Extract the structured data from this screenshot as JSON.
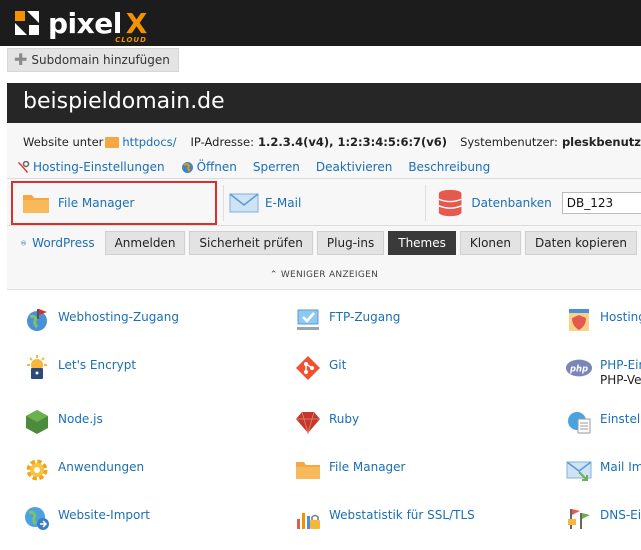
{
  "brand": {
    "name": "pixel",
    "mark": "X",
    "tagline": "CLOUD"
  },
  "toolbar": {
    "add_subdomain_label": "Subdomain hinzufügen"
  },
  "domain": {
    "title": "beispieldomain.de",
    "website_prefix": "Website unter",
    "docroot": "httpdocs/",
    "ip_label": "IP-Adresse:",
    "ip_value": "1.2.3.4(v4), 1:2:3:4:5:6:7(v6)",
    "user_label": "Systembenutzer:",
    "user_value": "pleskbenutzer"
  },
  "actions": [
    {
      "label": "Hosting-Einstellungen",
      "icon": "wrench-icon"
    },
    {
      "label": "Öffnen",
      "icon": "globe-icon"
    },
    {
      "label": "Sperren"
    },
    {
      "label": "Deaktivieren"
    },
    {
      "label": "Beschreibung"
    }
  ],
  "tools": {
    "file_manager": "File Manager",
    "email": "E-Mail",
    "databases": "Datenbanken",
    "db_selected": "DB_123"
  },
  "wordpress": {
    "label": "WordPress",
    "buttons": [
      "Anmelden",
      "Sicherheit prüfen",
      "Plug-ins",
      "Themes",
      "Klonen",
      "Daten kopieren"
    ],
    "active": "Themes"
  },
  "show_less": "WENIGER ANZEIGEN",
  "grid": {
    "col1": [
      "Webhosting-Zugang",
      "Let's Encrypt",
      "Node.js",
      "Anwendungen",
      "Website-Import"
    ],
    "col2": [
      "FTP-Zugang",
      "Git",
      "Ruby",
      "File Manager",
      "Webstatistik für SSL/TLS"
    ],
    "col3": [
      "Hosting",
      "PHP-Ein",
      "Einstell",
      "Mail Im",
      "DNS-Ein"
    ],
    "col3_sub": "PHP-Ve"
  },
  "colors": {
    "accent_link": "#1a6fb5",
    "highlight_border": "#d9302b",
    "brand_orange": "#f39200",
    "header_bg": "#262626"
  }
}
